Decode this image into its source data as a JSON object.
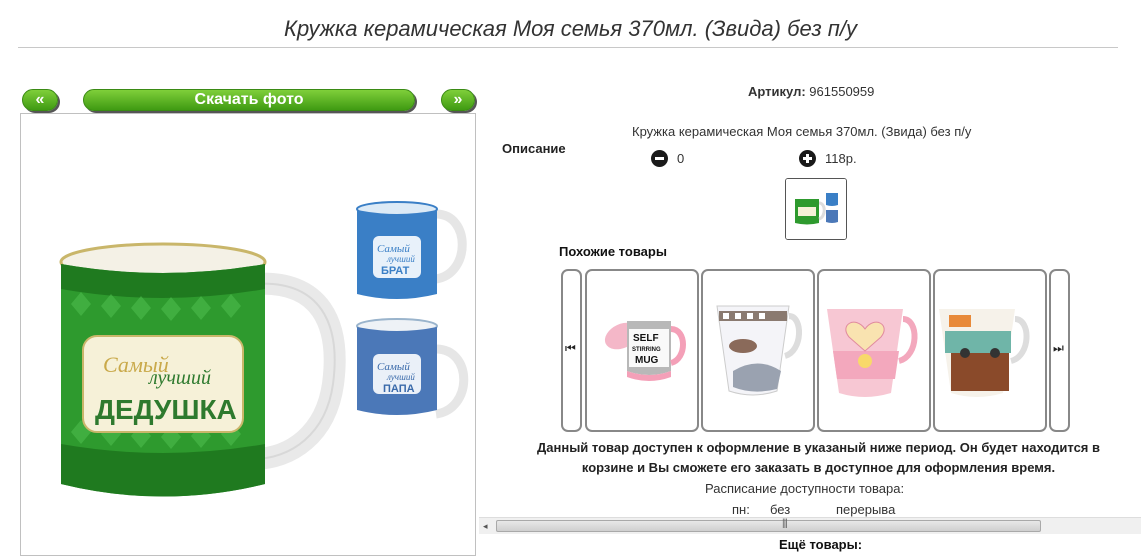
{
  "header": {
    "title": "Кружка керамическая Моя семья 370мл. (Звида) без п/у"
  },
  "gallery": {
    "prev_label": "«",
    "download_label": "Скачать фото",
    "next_label": "»",
    "mug_main_line1": "Самый",
    "mug_main_line2": "лучший",
    "mug_main_line3": "ДЕДУШКА",
    "mug_top_line1": "Самый",
    "mug_top_line2": "лучший",
    "mug_top_line3": "БРАТ",
    "mug_bottom_line1": "Самый",
    "mug_bottom_line2": "лучший",
    "mug_bottom_line3": "ПАПА"
  },
  "product": {
    "article_label": "Артикул:",
    "article_value": "961550959",
    "description_label": "Описание",
    "description_text": "Кружка керамическая Моя семья 370мл. (Звида) без п/у",
    "quantity": "0",
    "price": "118р."
  },
  "similar": {
    "title": "Похожие товары",
    "prev_icon": "⏮",
    "next_icon": "⏭",
    "items": [
      {
        "label_line1": "SELF",
        "label_line2": "STIRRING",
        "label_line3": "MUG"
      },
      {
        "label": ""
      },
      {
        "label": ""
      },
      {
        "label": ""
      }
    ]
  },
  "availability": {
    "notice_line1": "Данный товар доступен к оформление в указаный ниже период. Он будет находится в",
    "notice_line2": "корзине и Вы сможете его заказать в доступное для оформления время.",
    "schedule_title": "Расписание доступности товара:",
    "day": "пн:",
    "status": "без",
    "status2": "перерыва"
  },
  "scrollbar": {
    "left_arrow": "◂",
    "grip": "|||"
  },
  "more": {
    "title": "Ещё товары:"
  },
  "colors": {
    "button_green": "#4caf1e",
    "mug_green": "#2e9a2e",
    "mug_blue": "#3a7fc6"
  }
}
